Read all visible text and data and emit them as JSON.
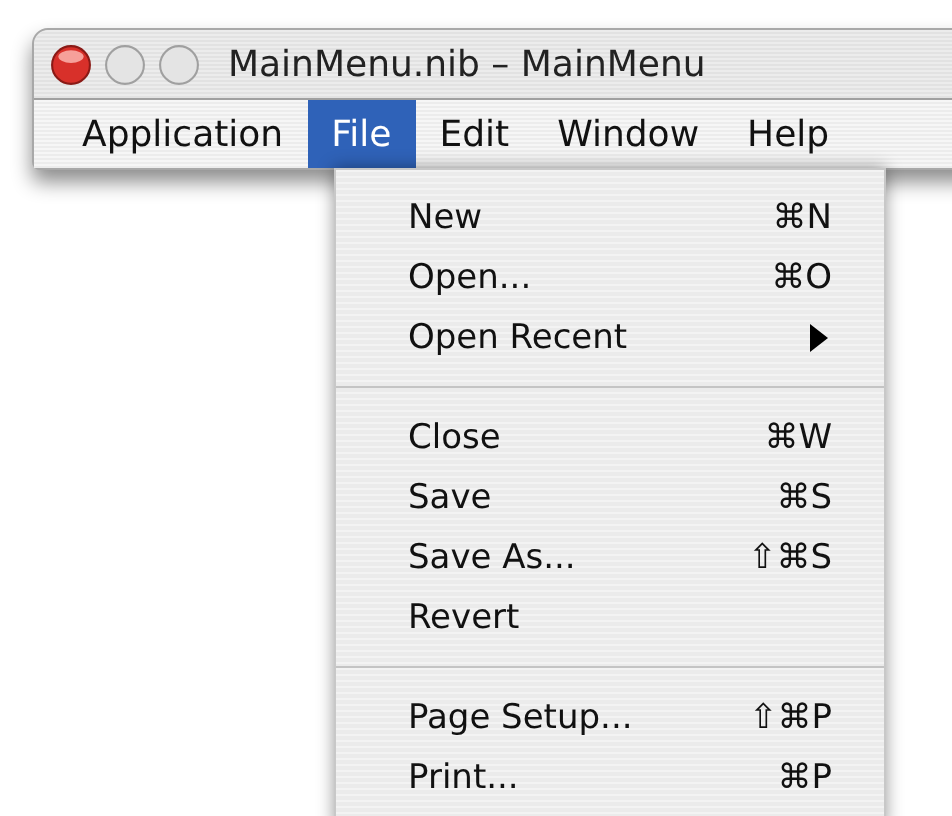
{
  "window": {
    "title": "MainMenu.nib – MainMenu"
  },
  "menu_bar": [
    {
      "label": "Application",
      "selected": false
    },
    {
      "label": "File",
      "selected": true
    },
    {
      "label": "Edit",
      "selected": false
    },
    {
      "label": "Window",
      "selected": false
    },
    {
      "label": "Help",
      "selected": false
    }
  ],
  "file_menu": {
    "sections": [
      {
        "items": [
          {
            "label": "New",
            "shortcut": "⌘N",
            "submenu": false
          },
          {
            "label": "Open...",
            "shortcut": "⌘O",
            "submenu": false
          },
          {
            "label": "Open Recent",
            "submenu": true
          }
        ]
      },
      {
        "items": [
          {
            "label": "Close",
            "shortcut": "⌘W",
            "submenu": false
          },
          {
            "label": "Save",
            "shortcut": "⌘S",
            "submenu": false
          },
          {
            "label": "Save As...",
            "shortcut": "⇧⌘S",
            "submenu": false
          },
          {
            "label": "Revert",
            "submenu": false
          }
        ]
      },
      {
        "items": [
          {
            "label": "Page Setup...",
            "shortcut": "⇧⌘P",
            "submenu": false
          },
          {
            "label": "Print...",
            "shortcut": "⌘P",
            "submenu": false
          }
        ]
      }
    ]
  }
}
